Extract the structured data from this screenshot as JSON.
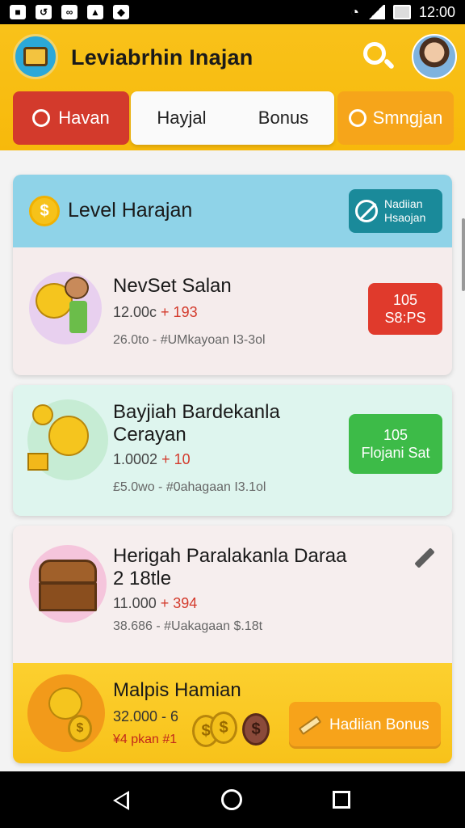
{
  "status_bar": {
    "time": "12:00"
  },
  "header": {
    "title": "Leviabrhin Inajan",
    "tabs": [
      {
        "label": "Havan",
        "color": "#d33a2c"
      },
      {
        "label": "Hayjal"
      },
      {
        "label": "Bonus"
      },
      {
        "label": "Smngjan",
        "color": "#f6a51a"
      }
    ]
  },
  "level_card": {
    "title": "Level Harajan",
    "button_label": "Nadiian Hsaojan"
  },
  "items": [
    {
      "title": "NevSet Salan",
      "line1_prefix": "12.00c ",
      "line1_highlight": "+ 193",
      "line2": "26.0to - #UMkayoan I3-3ol",
      "pill_top": "105",
      "pill_bottom": "S8:PS",
      "pill_color": "#e03a2c"
    },
    {
      "title": "Bayjiah Bardekanla Cerayan",
      "line1_prefix": "1.0002 ",
      "line1_highlight": "+ 10",
      "line2": "£5.0wo - #0ahagaan I3.1ol",
      "pill_top": "105",
      "pill_bottom": "Flojani Sat",
      "pill_color": "#3dbb48"
    },
    {
      "title": "Herigah Paralakanla Daraa 2 18tle",
      "line1_prefix": "11.000 ",
      "line1_highlight": "+ 394",
      "line2": "38.686 - #Uakagaan $.18t"
    }
  ],
  "bonus_section": {
    "title": "Malpis Hamian",
    "line1": "32.000 - 6",
    "line2": "¥4 pkan #1",
    "button_label": "Hadiian Bonus"
  },
  "icons": [
    "app-logo-icon",
    "search-icon",
    "avatar",
    "coin-icon",
    "ban-icon",
    "pencil-icon",
    "treasure-chest-icon",
    "nav-back-icon",
    "nav-home-icon",
    "nav-recent-icon"
  ]
}
